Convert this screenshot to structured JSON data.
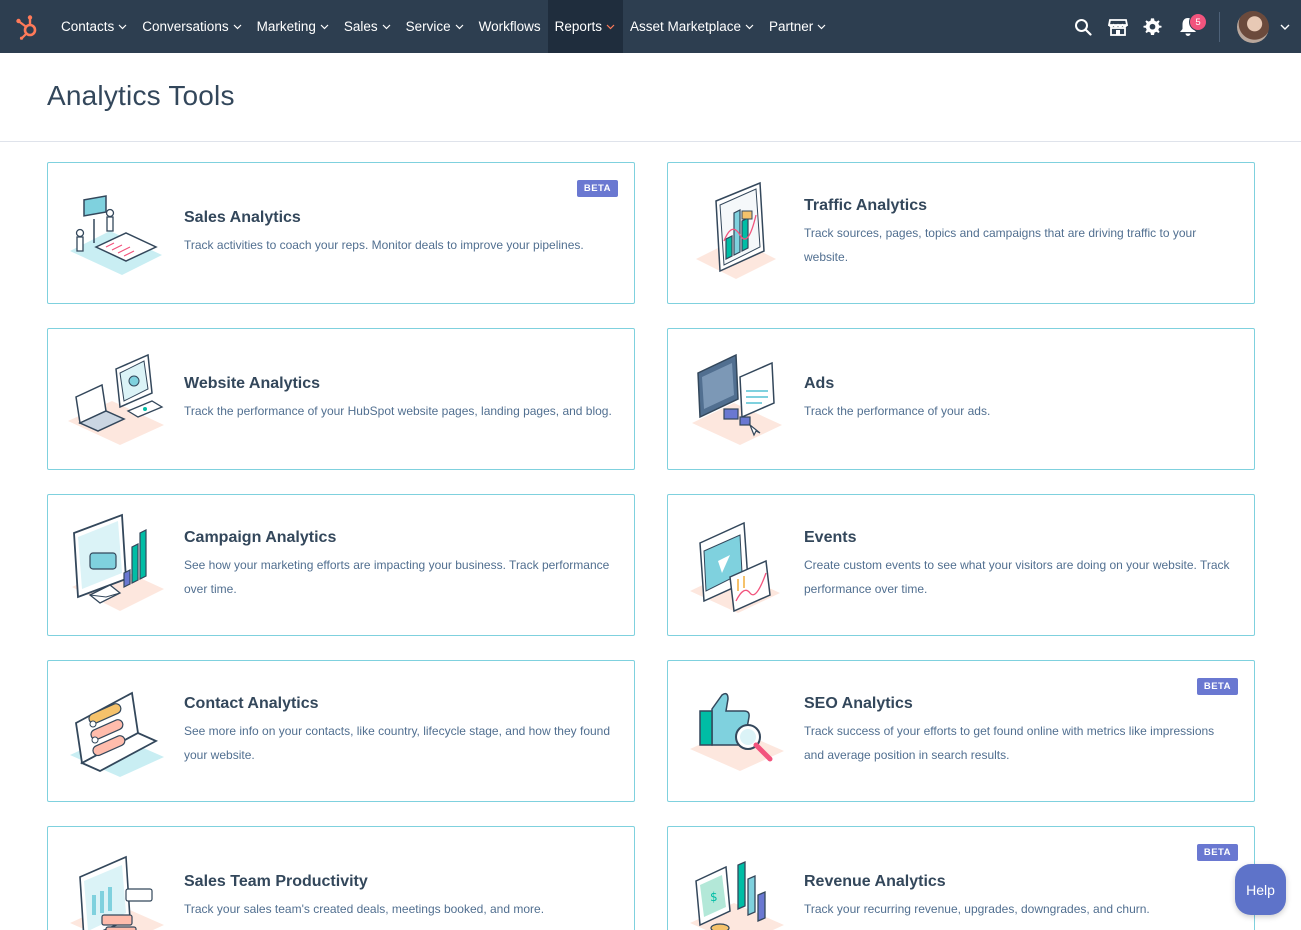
{
  "nav": {
    "items": [
      {
        "label": "Contacts",
        "has_caret": true
      },
      {
        "label": "Conversations",
        "has_caret": true
      },
      {
        "label": "Marketing",
        "has_caret": true
      },
      {
        "label": "Sales",
        "has_caret": true
      },
      {
        "label": "Service",
        "has_caret": true
      },
      {
        "label": "Workflows",
        "has_caret": false
      },
      {
        "label": "Reports",
        "has_caret": true,
        "active": true
      },
      {
        "label": "Asset Marketplace",
        "has_caret": true
      },
      {
        "label": "Partner",
        "has_caret": true
      }
    ],
    "notification_count": "5",
    "icons": [
      "search-icon",
      "marketplace-icon",
      "gear-icon",
      "bell-icon"
    ]
  },
  "page": {
    "title": "Analytics Tools"
  },
  "cards": [
    {
      "title": "Sales Analytics",
      "desc": "Track activities to coach your reps. Monitor deals to improve your pipelines.",
      "badge": "BETA"
    },
    {
      "title": "Traffic Analytics",
      "desc": "Track sources, pages, topics and campaigns that are driving traffic to your website.",
      "badge": ""
    },
    {
      "title": "Website Analytics",
      "desc": "Track the performance of your HubSpot website pages, landing pages, and blog.",
      "badge": ""
    },
    {
      "title": "Ads",
      "desc": "Track the performance of your ads.",
      "badge": ""
    },
    {
      "title": "Campaign Analytics",
      "desc": "See how your marketing efforts are impacting your business. Track performance over time.",
      "badge": ""
    },
    {
      "title": "Events",
      "desc": "Create custom events to see what your visitors are doing on your website. Track performance over time.",
      "badge": ""
    },
    {
      "title": "Contact Analytics",
      "desc": "See more info on your contacts, like country, lifecycle stage, and how they found your website.",
      "badge": ""
    },
    {
      "title": "SEO Analytics",
      "desc": "Track success of your efforts to get found online with metrics like impressions and average position in search results.",
      "badge": "BETA"
    },
    {
      "title": "Sales Team Productivity",
      "desc": "Track your sales team's created deals, meetings booked, and more.",
      "badge": ""
    },
    {
      "title": "Revenue Analytics",
      "desc": "Track your recurring revenue, upgrades, downgrades, and churn.",
      "badge": "BETA"
    }
  ],
  "help": {
    "label": "Help"
  },
  "colors": {
    "nav_bg": "#2d3e50",
    "card_border": "#7fd1de",
    "badge": "#6a78d1",
    "accent": "#ff7a59"
  }
}
